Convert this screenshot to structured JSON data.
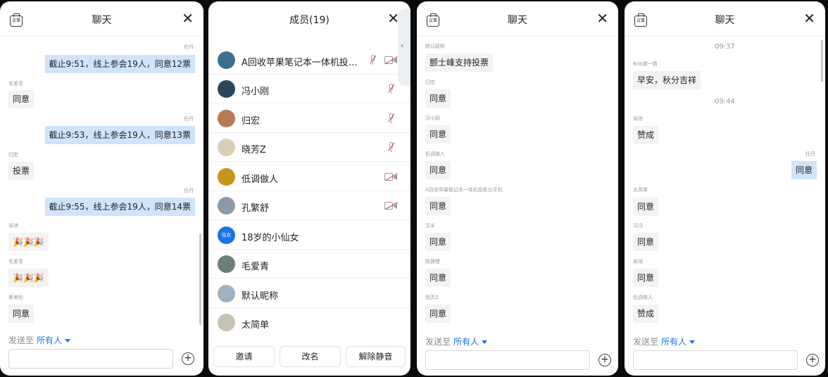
{
  "panel1": {
    "title": "聊天",
    "clip_text": "议事",
    "messages": [
      {
        "sender": "任丹",
        "text": "截止9:51，线上参会19人，同意12票",
        "side": "right"
      },
      {
        "sender": "毛爱青",
        "text": "同意",
        "side": "left"
      },
      {
        "sender": "任丹",
        "text": "截止9:53，线上参会19人，同意13票",
        "side": "right"
      },
      {
        "sender": "归宏",
        "text": "投票",
        "side": "left"
      },
      {
        "sender": "任丹",
        "text": "截止9:55，线上参会19人，同意14票",
        "side": "right"
      },
      {
        "sender": "吴琼",
        "text": "🎉🎉🎉",
        "side": "left"
      },
      {
        "sender": "毛爱青",
        "text": "🎉🎉🎉",
        "side": "left"
      },
      {
        "sender": "秦美松",
        "text": "同意",
        "side": "left"
      }
    ],
    "send_to_label": "发送至",
    "send_to_target": "所有人"
  },
  "panel2": {
    "title": "成员(19)",
    "members": [
      {
        "name": "A回收苹果笔记本一体机投影仪手机",
        "mic_muted": true,
        "cam_off": true,
        "avatar": "#3f6f8f"
      },
      {
        "name": "冯小刚",
        "mic_muted": true,
        "cam_off": false,
        "avatar": "#2e4457"
      },
      {
        "name": "归宏",
        "mic_muted": true,
        "cam_off": false,
        "avatar": "#b77a56"
      },
      {
        "name": "晓芳Z",
        "mic_muted": true,
        "cam_off": false,
        "avatar": "#d9cdb8"
      },
      {
        "name": "低调做人",
        "mic_muted": false,
        "cam_off": true,
        "avatar": "#c4961c"
      },
      {
        "name": "孔繁舒",
        "mic_muted": false,
        "cam_off": true,
        "avatar": "#8c99a6"
      },
      {
        "name": "18岁的小仙女",
        "mic_muted": false,
        "cam_off": false,
        "avatar": "#1a73e8",
        "avatar_text": "仙女"
      },
      {
        "name": "毛爱青",
        "mic_muted": false,
        "cam_off": false,
        "avatar": "#6a7f7a"
      },
      {
        "name": "默认昵称",
        "mic_muted": false,
        "cam_off": false,
        "avatar": "#9fb2c2"
      },
      {
        "name": "太简单",
        "mic_muted": false,
        "cam_off": false,
        "avatar": "#c8c2b4"
      }
    ],
    "buttons": {
      "invite": "邀请",
      "rename": "改名",
      "unmute": "解除静音"
    },
    "collapse_glyph": "‹"
  },
  "panel3": {
    "title": "聊天",
    "clip_text": "议事",
    "messages": [
      {
        "sender": "默认昵称",
        "text": "颤士峰支持投票"
      },
      {
        "sender": "归宏",
        "text": "同意"
      },
      {
        "sender": "冯小刚",
        "text": "同意"
      },
      {
        "sender": "低调做人",
        "text": "同意"
      },
      {
        "sender": "A回收苹果笔记本一体机投影仪手机",
        "text": "同意"
      },
      {
        "sender": "艾米",
        "text": "同意"
      },
      {
        "sender": "陈静慧",
        "text": "同意"
      },
      {
        "sender": "晓芳Z",
        "text": "同意"
      }
    ],
    "send_to_label": "发送至",
    "send_to_target": "所有人"
  },
  "panel4": {
    "title": "聊天",
    "clip_text": "议事",
    "time1": "09:37",
    "time2": "09:44",
    "messages": [
      {
        "sender": "Bob顺一猜",
        "text": "早安，秋分吉祥",
        "side": "left"
      },
      {
        "sender": "吴琼",
        "text": "赞成",
        "side": "left"
      },
      {
        "sender": "任丹",
        "text": "同意",
        "side": "right"
      },
      {
        "sender": "太简单",
        "text": "同意",
        "side": "left"
      },
      {
        "sender": "冯冯",
        "text": "同意",
        "side": "left"
      },
      {
        "sender": "吴琦",
        "text": "同意",
        "side": "left"
      },
      {
        "sender": "低调做人",
        "text": "赞成",
        "side": "left"
      }
    ],
    "send_to_label": "发送至",
    "send_to_target": "所有人"
  },
  "icons": {
    "close": "close-icon",
    "plus": "plus-icon",
    "clipboard": "clipboard-icon",
    "mic_muted": "mic-muted-icon",
    "camera_off": "camera-off-icon"
  },
  "colors": {
    "self_bubble": "#cfe4fb",
    "other_bubble": "#f3f3f3",
    "accent": "#1a73e8",
    "muted_slash": "#d43b3b"
  }
}
